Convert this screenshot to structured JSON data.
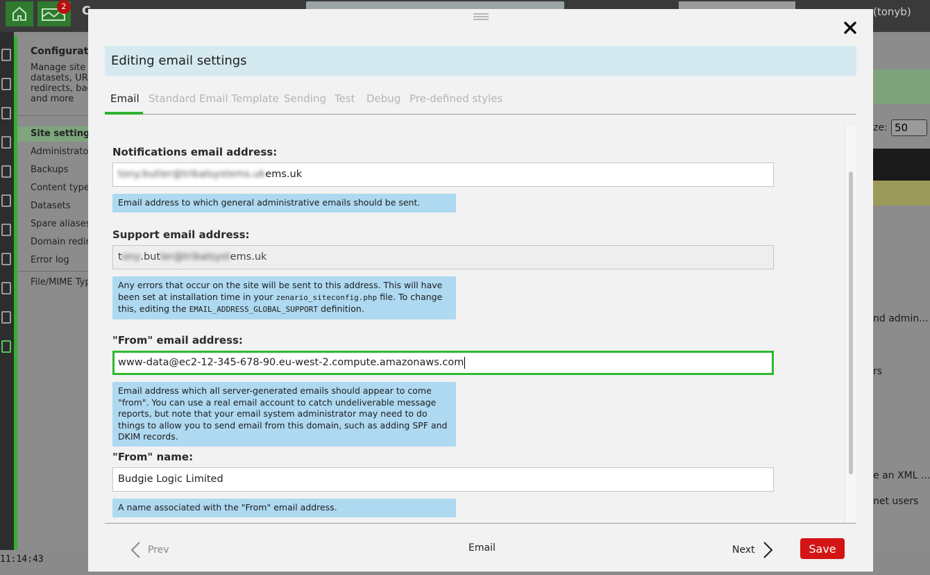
{
  "background": {
    "notification_count": "2",
    "app_initial": "C",
    "user_label": "(tonyb)",
    "panel_title": "Configurat",
    "panel_description": "Manage site datasets, URL redirects, bac and more",
    "nav_items": [
      "Site settings",
      "Administrator",
      "Backups",
      "Content types",
      "Datasets",
      "Spare aliases",
      "Domain redire",
      "Error log",
      "File/MIME Typ"
    ],
    "page_size_label": "ze:",
    "page_size_value": "50",
    "right_fragments": [
      "nd admin...",
      "rs",
      "e an XML ...",
      "net users"
    ],
    "clock": "11:14:43"
  },
  "modal": {
    "title": "Editing email settings",
    "tabs": [
      "Email",
      "Standard Email Template",
      "Sending",
      "Test",
      "Debug",
      "Pre-defined styles"
    ],
    "active_tab": "Email",
    "fields": {
      "notifications": {
        "label": "Notifications email address:",
        "value_hidden": "tony.butler@tribalsystems.uk",
        "value_visible_suffix": "ems.uk",
        "note": "Email address to which general administrative emails should be sent."
      },
      "support": {
        "label": "Support email address:",
        "value_prefix": "t",
        "value_middle": ".but",
        "value_suffix": "ems.uk",
        "note_part1": "Any errors that occur on the site will be sent to this address. This will have been set at installation time in your",
        "note_code1": "zenario_siteconfig.php",
        "note_part2": "file. To change this, editing the",
        "note_code2": "EMAIL_ADDRESS_GLOBAL_SUPPORT",
        "note_part3": "definition."
      },
      "from_email": {
        "label": "\"From\" email address:",
        "value": "www-data@ec2-12-345-678-90.eu-west-2.compute.amazonaws.com",
        "note": "Email address which all server-generated emails should appear to come \"from\". You can use a real email account to catch undeliverable message reports, but note that your email system administrator may need to do things to allow you to send email from this domain, such as adding SPF and DKIM records."
      },
      "from_name": {
        "label": "\"From\" name:",
        "value": "Budgie Logic Limited",
        "note": "A name associated with the \"From\" email address."
      }
    },
    "footer": {
      "prev_label": "Prev",
      "step_label": "Email",
      "next_label": "Next",
      "save_label": "Save"
    }
  },
  "colors": {
    "accent_green": "#2fb82f",
    "save_red": "#d31414",
    "note_blue": "#aed9f1",
    "title_blue": "#d5eaf0"
  },
  "icons": [
    "home-icon",
    "alerts-icon",
    "grip-icon",
    "close-icon",
    "chevron-left-icon",
    "chevron-right-icon"
  ]
}
